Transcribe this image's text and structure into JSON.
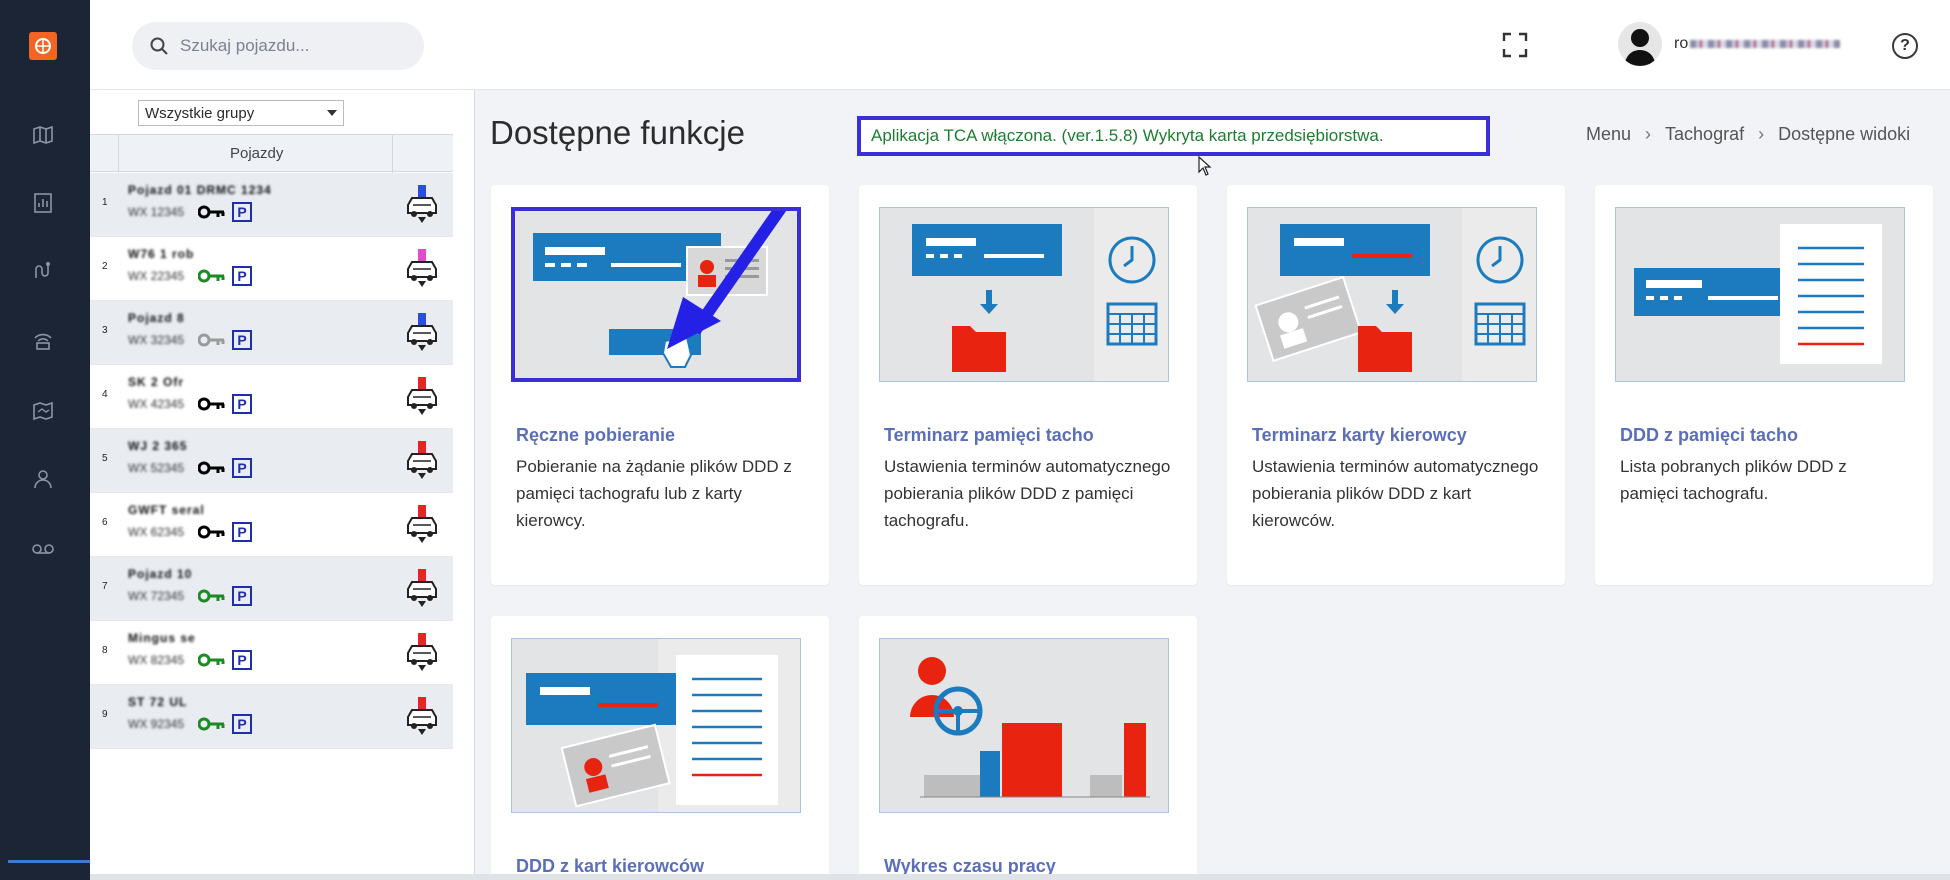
{
  "search": {
    "placeholder": "Szukaj pojazdu..."
  },
  "user": {
    "name_visible": "ro"
  },
  "help": {
    "label": "?"
  },
  "group_select": {
    "selected": "Wszystkie grupy"
  },
  "vehicles": {
    "column_header": "Pojazdy",
    "rows": [
      {
        "index": "1",
        "name": "Pojazd 01 DRMC 1234",
        "code": "WX 12345",
        "key_color": "#000000",
        "car_color": "#2a4fd8"
      },
      {
        "index": "2",
        "name": "W76 1 rob",
        "code": "WX 22345",
        "key_color": "#1e8a24",
        "car_color": "#e24ac8"
      },
      {
        "index": "3",
        "name": "Pojazd 8",
        "code": "WX 32345",
        "key_color": "#9a9a9a",
        "car_color": "#2a4fd8"
      },
      {
        "index": "4",
        "name": "SK 2 Ofr",
        "code": "WX 42345",
        "key_color": "#000000",
        "car_color": "#e32626"
      },
      {
        "index": "5",
        "name": "WJ 2 365",
        "code": "WX 52345",
        "key_color": "#000000",
        "car_color": "#e32626"
      },
      {
        "index": "6",
        "name": "GWFT seral",
        "code": "WX 62345",
        "key_color": "#000000",
        "car_color": "#e32626"
      },
      {
        "index": "7",
        "name": "Pojazd 10",
        "code": "WX 72345",
        "key_color": "#1e8a24",
        "car_color": "#e32626"
      },
      {
        "index": "8",
        "name": "Mingus se",
        "code": "WX 82345",
        "key_color": "#1e8a24",
        "car_color": "#e32626"
      },
      {
        "index": "9",
        "name": "ST 72 UL",
        "code": "WX 92345",
        "key_color": "#1e8a24",
        "car_color": "#e32626"
      }
    ],
    "parking_label": "P"
  },
  "page": {
    "title": "Dostępne funkcje"
  },
  "notice": {
    "text": "Aplikacja TCA włączona. (ver.1.5.8)   Wykryta karta przedsiębiorstwa."
  },
  "breadcrumb": {
    "items": [
      "Menu",
      "Tachograf",
      "Dostępne widoki"
    ],
    "separator": "›"
  },
  "cards": [
    {
      "title": "Ręczne pobieranie",
      "desc": "Pobieranie na żądanie plików DDD z pamięci tachografu lub z karty kierowcy.",
      "icon": "manual-download-icon"
    },
    {
      "title": "Terminarz pamięci tacho",
      "desc": "Ustawienia terminów automatycznego pobierania plików DDD z pamięci tachografu.",
      "icon": "tacho-memory-schedule-icon"
    },
    {
      "title": "Terminarz karty kierowcy",
      "desc": "Ustawienia terminów automatycznego pobierania plików DDD z kart kierowców.",
      "icon": "driver-card-schedule-icon"
    },
    {
      "title": "DDD z pamięci tacho",
      "desc": "Lista pobranych plików DDD z pamięci tachografu.",
      "icon": "ddd-memory-list-icon"
    },
    {
      "title": "DDD z kart kierowców",
      "desc": "",
      "icon": "ddd-driver-cards-icon"
    },
    {
      "title": "Wykres czasu pracy",
      "desc": "",
      "icon": "work-time-chart-icon"
    }
  ],
  "colors": {
    "accent": "#5b6fb8",
    "notice_border": "#3a2fd6",
    "notice_text": "#1f7d31",
    "rail": "#1b2535",
    "brand": "#f26522",
    "illus_blue": "#1c7bbf",
    "illus_red": "#e8230f"
  }
}
